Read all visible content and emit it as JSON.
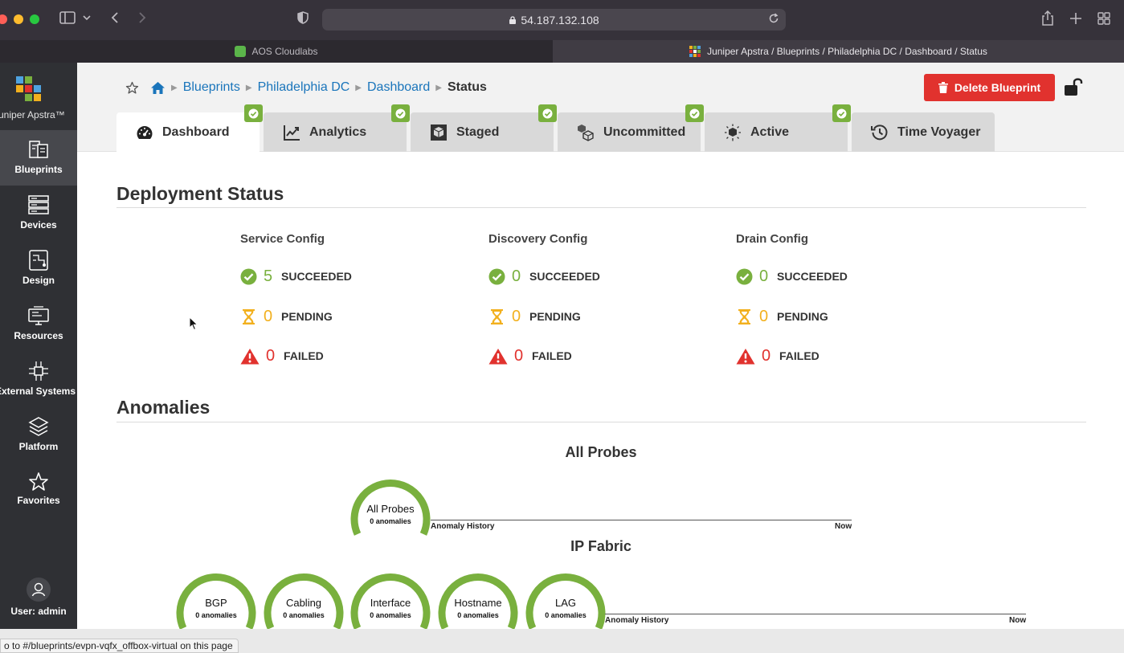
{
  "browser": {
    "url": "54.187.132.108",
    "tabs": [
      {
        "label": "AOS Cloudlabs"
      },
      {
        "label": "Juniper Apstra / Blueprints / Philadelphia DC / Dashboard / Status"
      }
    ]
  },
  "sidebar": {
    "brand": "Juniper Apstra™",
    "items": [
      {
        "label": "Blueprints",
        "icon": "blueprints-icon"
      },
      {
        "label": "Devices",
        "icon": "devices-icon"
      },
      {
        "label": "Design",
        "icon": "design-icon"
      },
      {
        "label": "Resources",
        "icon": "resources-icon"
      },
      {
        "label": "External Systems",
        "icon": "external-systems-icon"
      },
      {
        "label": "Platform",
        "icon": "platform-icon"
      },
      {
        "label": "Favorites",
        "icon": "star-icon"
      }
    ],
    "user": "User: admin"
  },
  "breadcrumb": {
    "items": [
      "Blueprints",
      "Philadelphia DC",
      "Dashboard"
    ],
    "current": "Status"
  },
  "header": {
    "delete_label": "Delete Blueprint"
  },
  "tabs": [
    {
      "label": "Dashboard",
      "active": true
    },
    {
      "label": "Analytics"
    },
    {
      "label": "Staged"
    },
    {
      "label": "Uncommitted"
    },
    {
      "label": "Active"
    },
    {
      "label": "Time Voyager"
    }
  ],
  "deployment": {
    "title": "Deployment Status",
    "columns": [
      {
        "title": "Service Config",
        "succeeded": "5",
        "pending": "0",
        "failed": "0"
      },
      {
        "title": "Discovery Config",
        "succeeded": "0",
        "pending": "0",
        "failed": "0"
      },
      {
        "title": "Drain Config",
        "succeeded": "0",
        "pending": "0",
        "failed": "0"
      }
    ],
    "labels": {
      "succeeded": "SUCCEEDED",
      "pending": "PENDING",
      "failed": "FAILED"
    }
  },
  "anomalies": {
    "title": "Anomalies",
    "all_probes": {
      "heading": "All Probes",
      "gauge": {
        "name": "All Probes",
        "sub": "0 anomalies"
      }
    },
    "ip_fabric": {
      "heading": "IP Fabric",
      "gauges": [
        {
          "name": "BGP",
          "sub": "0 anomalies"
        },
        {
          "name": "Cabling",
          "sub": "0 anomalies"
        },
        {
          "name": "Interface",
          "sub": "0 anomalies"
        },
        {
          "name": "Hostname",
          "sub": "0 anomalies"
        },
        {
          "name": "LAG",
          "sub": "0 anomalies"
        }
      ]
    },
    "history_label": "Anomaly History",
    "now_label": "Now"
  },
  "status_bar": {
    "text": "o to #/blueprints/evpn-vqfx_offbox-virtual on this page"
  },
  "colors": {
    "success": "#79b03e",
    "pending": "#f2b01e",
    "failed": "#e1322e",
    "link": "#1a75bb",
    "sidebar": "#2f3034"
  }
}
